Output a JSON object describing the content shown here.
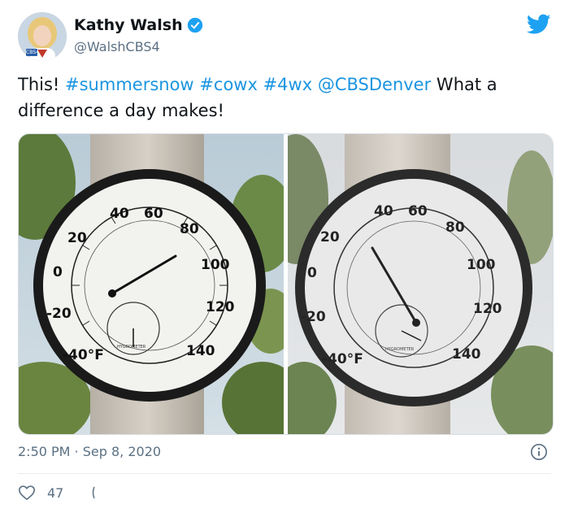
{
  "author": {
    "display_name": "Kathy Walsh",
    "handle": "@WalshCBS4",
    "badge": "CBS4",
    "verified": true
  },
  "brand": {
    "icon": "twitter-bird-icon",
    "color": "#1da1f2"
  },
  "tweet": {
    "text_start": "This! ",
    "hashtag1": "#summersnow",
    "hashtag2": "#cowx",
    "hashtag3": "#4wx",
    "mention": "@CBSDenver",
    "text_end": " What a difference a day makes!"
  },
  "gauge_labels": [
    "40",
    "60",
    "80",
    "100",
    "120",
    "140",
    "20",
    "0",
    "-20",
    "-40°F"
  ],
  "hygrometer_label": "HYGROMETER",
  "footer": {
    "time": "2:50 PM",
    "separator": " · ",
    "date": "Sep 8, 2020",
    "info_icon": "info-icon"
  },
  "actions": {
    "like_count": "47",
    "like_icon": "heart-icon",
    "reply_icon": "reply-icon"
  },
  "colors": {
    "link": "#1b95e0",
    "secondary": "#5b7083"
  }
}
